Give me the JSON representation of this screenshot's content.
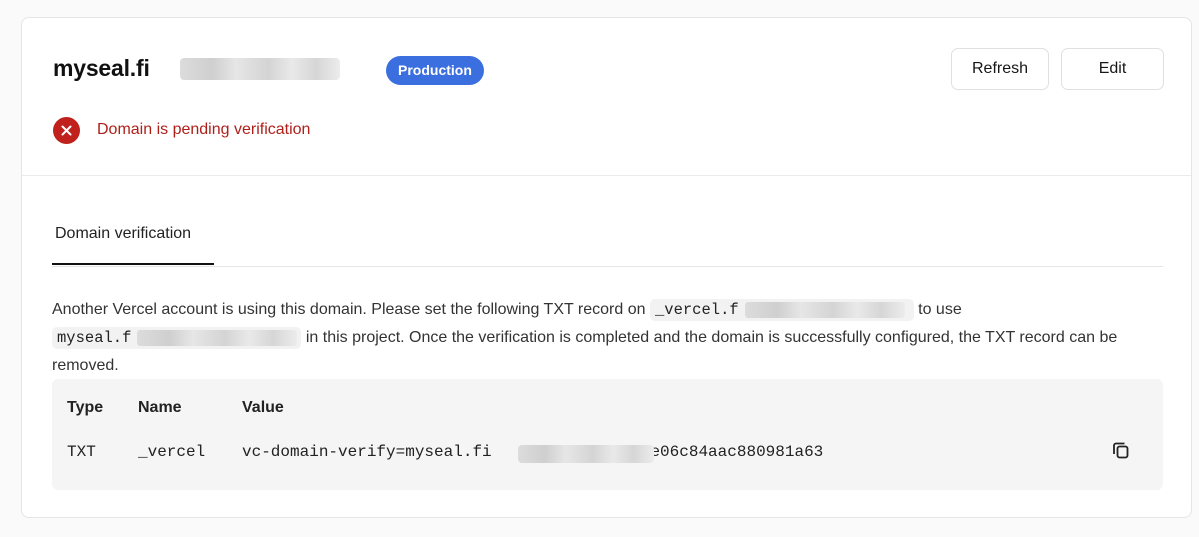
{
  "domain": {
    "name_visible": "myseal.fi",
    "environment_badge": "Production",
    "status": "Domain is pending verification"
  },
  "actions": {
    "refresh_label": "Refresh",
    "edit_label": "Edit"
  },
  "tabs": [
    {
      "label": "Domain verification",
      "active": true
    }
  ],
  "description": {
    "part1": "Another Vercel account is using this domain. Please set the following TXT record on ",
    "code1_visible": "_vercel.f",
    "part2": " to use ",
    "code2_visible": "myseal.f",
    "part3": " in this project. Once the verification is completed and the domain is successfully configured, the TXT record can be removed."
  },
  "record_table": {
    "headers": [
      "Type",
      "Name",
      "Value"
    ],
    "rows": [
      {
        "type": "TXT",
        "name": "_vercel",
        "value_prefix": "vc-domain-verify=myseal.fi",
        "value_suffix": ",65e06c84aac880981a63"
      }
    ]
  },
  "colors": {
    "accent": "#3b6fe0",
    "error": "#c0211c"
  },
  "icons": {
    "status": "x-circle-icon",
    "copy": "copy-icon"
  }
}
